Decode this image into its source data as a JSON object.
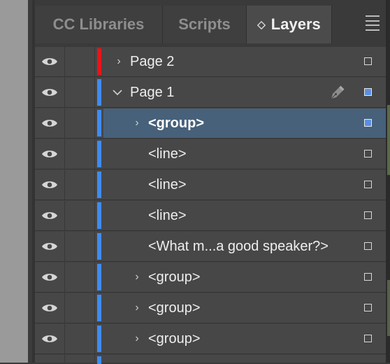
{
  "tabs": [
    {
      "label": "CC Libraries",
      "active": false
    },
    {
      "label": "Scripts",
      "active": false
    },
    {
      "label": "Layers",
      "active": true
    }
  ],
  "panel_menu_icon": "hamburger-menu-icon",
  "colors": {
    "page2_layer": "#e8141a",
    "page1_layer": "#3f8cf0",
    "selection": "#47617a",
    "selected_box": "#5a8fe0"
  },
  "rows": [
    {
      "label": "Page 2",
      "twisty": "›",
      "layer_color": "#e8141a"
    },
    {
      "label": "Page 1",
      "twisty": "⌄",
      "layer_color": "#3f8cf0"
    },
    {
      "label": "<group>",
      "twisty": "›",
      "layer_color": "#3f8cf0",
      "selected": true
    },
    {
      "label": "<line>",
      "twisty": "",
      "layer_color": "#3f8cf0"
    },
    {
      "label": "<line>",
      "twisty": "",
      "layer_color": "#3f8cf0"
    },
    {
      "label": "<line>",
      "twisty": "",
      "layer_color": "#3f8cf0"
    },
    {
      "label": "<What m...a good speaker?>",
      "twisty": "",
      "layer_color": "#3f8cf0"
    },
    {
      "label": "<group>",
      "twisty": "›",
      "layer_color": "#3f8cf0"
    },
    {
      "label": "<group>",
      "twisty": "›",
      "layer_color": "#3f8cf0"
    },
    {
      "label": "<group>",
      "twisty": "›",
      "layer_color": "#3f8cf0"
    }
  ]
}
